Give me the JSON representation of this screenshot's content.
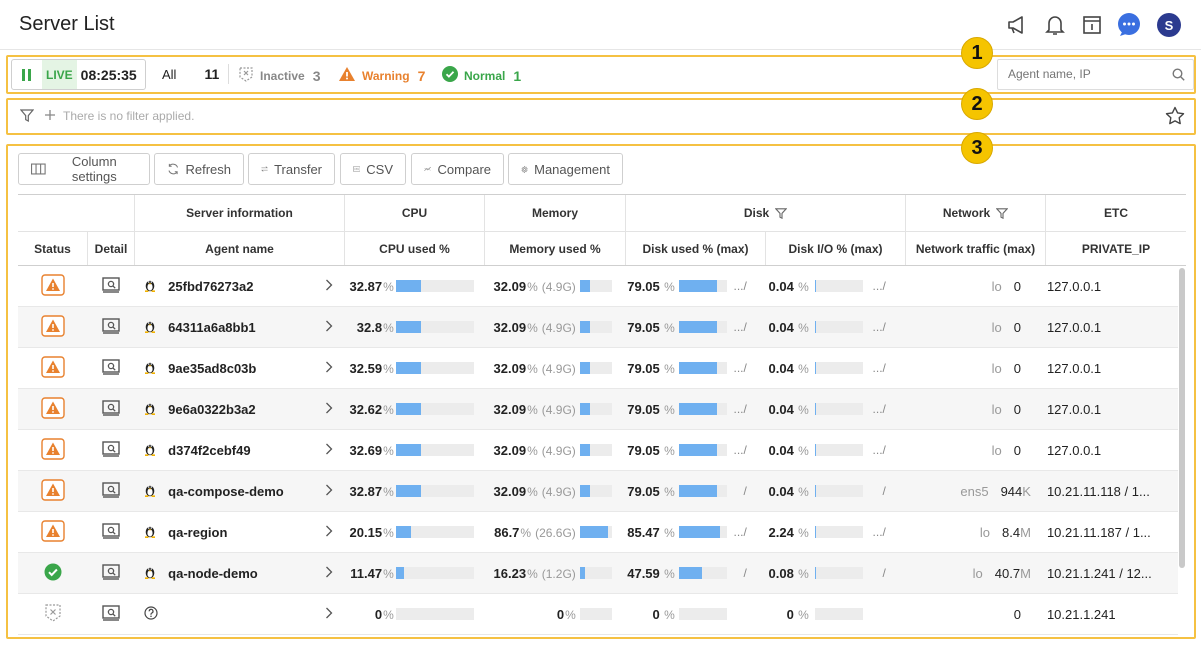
{
  "header": {
    "title": "Server List",
    "avatar_letter": "S"
  },
  "status_bar": {
    "live_label": "LIVE",
    "time": "08:25:35",
    "all_label": "All",
    "all_count": "11",
    "inactive_label": "Inactive",
    "inactive_count": "3",
    "warning_label": "Warning",
    "warning_count": "7",
    "normal_label": "Normal",
    "normal_count": "1",
    "search_placeholder": "Agent name, IP"
  },
  "filter": {
    "text": "There is no filter applied."
  },
  "badges": [
    "1",
    "2",
    "3"
  ],
  "toolbar": {
    "column_settings": "Column settings",
    "refresh": "Refresh",
    "transfer": "Transfer",
    "csv": "CSV",
    "compare": "Compare",
    "management": "Management"
  },
  "table": {
    "groups": {
      "server_information": "Server information",
      "cpu": "CPU",
      "memory": "Memory",
      "disk": "Disk",
      "network": "Network",
      "etc": "ETC"
    },
    "columns": {
      "status": "Status",
      "detail": "Detail",
      "agent_name": "Agent name",
      "cpu_used": "CPU used %",
      "memory_used": "Memory used %",
      "disk_used": "Disk used % (max)",
      "disk_io": "Disk I/O % (max)",
      "network_traffic": "Network traffic (max)",
      "private_ip": "PRIVATE_IP"
    },
    "rows": [
      {
        "status": "warning",
        "os": "linux",
        "name": "25fbd76273a2",
        "cpu": "32.87",
        "cpu_frac": 0.33,
        "mem": "32.09",
        "mem_size": "(4.9G)",
        "mem_frac": 0.32,
        "disk": "79.05",
        "disk_frac": 0.79,
        "disk_path": ".../",
        "io": "0.04",
        "io_frac": 0.004,
        "io_path": ".../",
        "iface": "lo",
        "traffic": "0",
        "traffic_unit": "",
        "ip": "127.0.0.1"
      },
      {
        "status": "warning",
        "os": "linux",
        "name": "64311a6a8bb1",
        "cpu": "32.8",
        "cpu_frac": 0.33,
        "mem": "32.09",
        "mem_size": "(4.9G)",
        "mem_frac": 0.32,
        "disk": "79.05",
        "disk_frac": 0.79,
        "disk_path": ".../",
        "io": "0.04",
        "io_frac": 0.004,
        "io_path": ".../",
        "iface": "lo",
        "traffic": "0",
        "traffic_unit": "",
        "ip": "127.0.0.1"
      },
      {
        "status": "warning",
        "os": "linux",
        "name": "9ae35ad8c03b",
        "cpu": "32.59",
        "cpu_frac": 0.33,
        "mem": "32.09",
        "mem_size": "(4.9G)",
        "mem_frac": 0.32,
        "disk": "79.05",
        "disk_frac": 0.79,
        "disk_path": ".../",
        "io": "0.04",
        "io_frac": 0.004,
        "io_path": ".../",
        "iface": "lo",
        "traffic": "0",
        "traffic_unit": "",
        "ip": "127.0.0.1"
      },
      {
        "status": "warning",
        "os": "linux",
        "name": "9e6a0322b3a2",
        "cpu": "32.62",
        "cpu_frac": 0.33,
        "mem": "32.09",
        "mem_size": "(4.9G)",
        "mem_frac": 0.32,
        "disk": "79.05",
        "disk_frac": 0.79,
        "disk_path": ".../",
        "io": "0.04",
        "io_frac": 0.004,
        "io_path": ".../",
        "iface": "lo",
        "traffic": "0",
        "traffic_unit": "",
        "ip": "127.0.0.1"
      },
      {
        "status": "warning",
        "os": "linux",
        "name": "d374f2cebf49",
        "cpu": "32.69",
        "cpu_frac": 0.33,
        "mem": "32.09",
        "mem_size": "(4.9G)",
        "mem_frac": 0.32,
        "disk": "79.05",
        "disk_frac": 0.79,
        "disk_path": ".../",
        "io": "0.04",
        "io_frac": 0.004,
        "io_path": ".../",
        "iface": "lo",
        "traffic": "0",
        "traffic_unit": "",
        "ip": "127.0.0.1"
      },
      {
        "status": "warning",
        "os": "linux",
        "name": "qa-compose-demo",
        "cpu": "32.87",
        "cpu_frac": 0.33,
        "mem": "32.09",
        "mem_size": "(4.9G)",
        "mem_frac": 0.32,
        "disk": "79.05",
        "disk_frac": 0.79,
        "disk_path": "/",
        "io": "0.04",
        "io_frac": 0.004,
        "io_path": "/",
        "iface": "ens5",
        "traffic": "944",
        "traffic_unit": "K",
        "ip": "10.21.11.118 / 1..."
      },
      {
        "status": "warning",
        "os": "linux",
        "name": "qa-region",
        "cpu": "20.15",
        "cpu_frac": 0.2,
        "mem": "86.7",
        "mem_size": "(26.6G)",
        "mem_frac": 0.87,
        "disk": "85.47",
        "disk_frac": 0.85,
        "disk_path": ".../",
        "io": "2.24",
        "io_frac": 0.02,
        "io_path": ".../",
        "iface": "lo",
        "traffic": "8.4",
        "traffic_unit": "M",
        "ip": "10.21.11.187 / 1..."
      },
      {
        "status": "normal",
        "os": "linux",
        "name": "qa-node-demo",
        "cpu": "11.47",
        "cpu_frac": 0.11,
        "mem": "16.23",
        "mem_size": "(1.2G)",
        "mem_frac": 0.16,
        "disk": "47.59",
        "disk_frac": 0.48,
        "disk_path": "/",
        "io": "0.08",
        "io_frac": 0.008,
        "io_path": "/",
        "iface": "lo",
        "traffic": "40.7",
        "traffic_unit": "M",
        "ip": "10.21.1.241 / 12..."
      },
      {
        "status": "inactive",
        "os": "unknown",
        "name": "",
        "cpu": "0",
        "cpu_frac": 0,
        "mem": "0",
        "mem_size": "",
        "mem_frac": 0,
        "disk": "0",
        "disk_frac": 0,
        "disk_path": "",
        "io": "0",
        "io_frac": 0,
        "io_path": "",
        "iface": "",
        "traffic": "0",
        "traffic_unit": "",
        "ip": "10.21.1.241"
      }
    ]
  },
  "colors": {
    "accent": "#f5c142",
    "warning": "#e8812e",
    "normal": "#3aa64a",
    "bar": "#6fb0f0",
    "avatar": "#2b3a8f"
  }
}
